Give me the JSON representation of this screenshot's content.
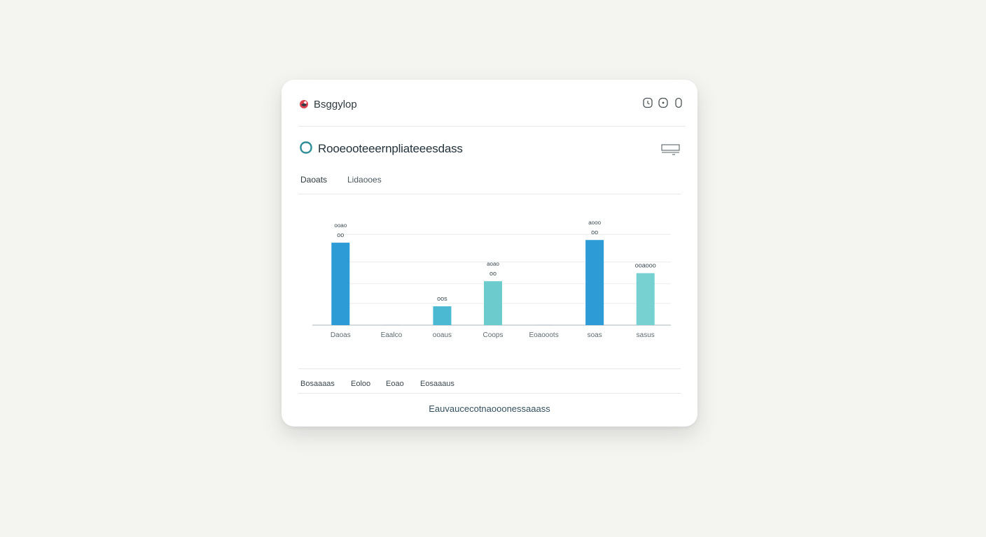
{
  "window": {
    "app_title": "Bsggylop",
    "controls": [
      "clock-icon",
      "info-icon",
      "lock-icon"
    ]
  },
  "page": {
    "title": "Rooeooteeernpliateeesdass",
    "menu_icon": "menu-icon"
  },
  "tabs": [
    {
      "label": "Daoats",
      "active": true
    },
    {
      "label": "Lidaooes",
      "active": false
    }
  ],
  "chart_data": {
    "type": "bar",
    "categories": [
      "Daoas",
      "Eaalco",
      "ooaus",
      "Coops",
      "Eoaooots",
      "soas",
      "sasus"
    ],
    "values": [
      92,
      0,
      21,
      49,
      0,
      95,
      58
    ],
    "bar_colors": [
      "#2d9bd6",
      null,
      "#4ab9d1",
      "#6ccbcd",
      null,
      "#2d9bd6",
      "#76d1d0"
    ],
    "data_labels": [
      {
        "category": "Daoas",
        "lines": [
          "ooao",
          "oo"
        ]
      },
      {
        "category": "ooaus",
        "lines": [
          "oos"
        ]
      },
      {
        "category": "Coops",
        "lines": [
          "aoao",
          "oo"
        ]
      },
      {
        "category": "soas",
        "lines": [
          "aooo",
          "oo"
        ]
      },
      {
        "category": "sasus",
        "lines": [
          "ooaooo"
        ]
      }
    ],
    "ylim": [
      0,
      110
    ],
    "grid": true
  },
  "legend": [
    "Bosaaaas",
    "Eoloo",
    "Eoao",
    "Eosaaaus"
  ],
  "footer": {
    "text": "Eauvaucecotnaooonessaaass"
  },
  "colors": {
    "accent": "#2d9bd6",
    "accent_light": "#76d1d0",
    "logo": "#d9434f",
    "teal": "#2e8d95"
  }
}
